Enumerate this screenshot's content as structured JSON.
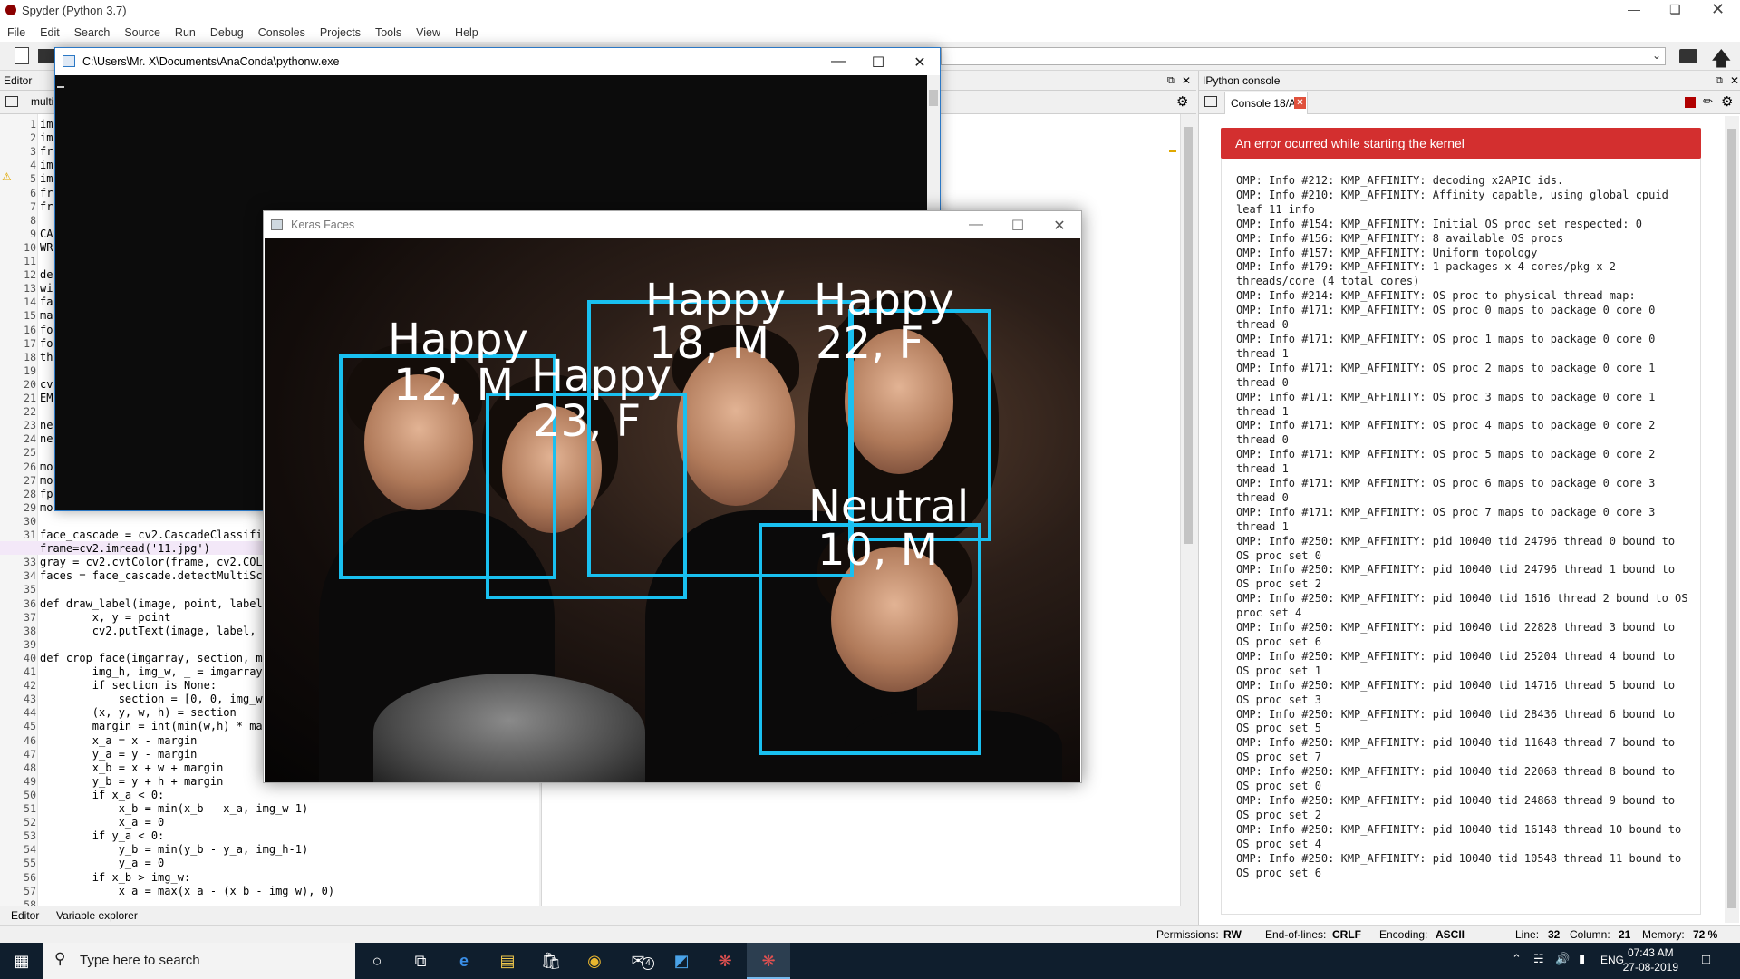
{
  "app": {
    "title": "Spyder (Python 3.7)"
  },
  "menu": [
    "File",
    "Edit",
    "Search",
    "Source",
    "Run",
    "Debug",
    "Consoles",
    "Projects",
    "Tools",
    "View",
    "Help"
  ],
  "editor": {
    "pane_title": "Editor",
    "tab": "multi",
    "line_numbers": [
      "1",
      "2",
      "3",
      "4",
      "5",
      "6",
      "7",
      "8",
      "9",
      "10",
      "11",
      "12",
      "13",
      "14",
      "15",
      "16",
      "17",
      "18",
      "19",
      "20",
      "21",
      "22",
      "23",
      "24",
      "25",
      "26",
      "27",
      "28",
      "29",
      "30",
      "31",
      "32",
      "33",
      "34",
      "35",
      "36",
      "37",
      "38",
      "39",
      "40",
      "41",
      "42",
      "43",
      "44",
      "45",
      "46",
      "47",
      "48",
      "49",
      "50",
      "51",
      "52",
      "53",
      "54",
      "55",
      "56",
      "57",
      "58"
    ],
    "code_lines": [
      "face_cascade = cv2.CascadeClassifie",
      "frame=cv2.imread('11.jpg')",
      "gray = cv2.cvtColor(frame, cv2.COLO",
      "faces = face_cascade.detectMultiSca",
      "",
      "def draw_label(image, point, label,",
      "        x, y = point",
      "        cv2.putText(image, label, p",
      "",
      "def crop_face(imgarray, section, ma",
      "        img_h, img_w, _ = imgarray.",
      "        if section is None:",
      "            section = [0, 0, img_w,",
      "        (x, y, w, h) = section",
      "        margin = int(min(w,h) * mar",
      "        x_a = x - margin",
      "        y_a = y - margin",
      "        x_b = x + w + margin",
      "        y_b = y + h + margin",
      "        if x_a < 0:",
      "            x_b = min(x_b - x_a, img_w-1)",
      "            x_a = 0",
      "        if y_a < 0:",
      "            y_b = min(y_b - y_a, img_h-1)",
      "            y_a = 0",
      "        if x_b > img_w:",
      "            x_a = max(x_a - (x_b - img_w), 0)"
    ],
    "left_fragments": [
      "im",
      "im",
      "fr",
      "im",
      "im",
      "fr",
      "fr",
      "",
      "CA",
      "WR",
      "",
      "de",
      "wi",
      "fa",
      "ma",
      "fo",
      "fo",
      "th",
      "",
      "cv",
      "EM",
      "",
      "ne",
      "ne",
      "",
      "mo",
      "mo",
      "fp",
      "mo"
    ]
  },
  "bottom_tabs": [
    "Editor",
    "Variable explorer"
  ],
  "console": {
    "pane_title": "IPython console",
    "tab": "Console 18/A",
    "error_banner": "An error ocurred while starting the kernel",
    "log": "OMP: Info #212: KMP_AFFINITY: decoding x2APIC ids.\nOMP: Info #210: KMP_AFFINITY: Affinity capable, using global cpuid leaf 11 info\nOMP: Info #154: KMP_AFFINITY: Initial OS proc set respected: 0\nOMP: Info #156: KMP_AFFINITY: 8 available OS procs\nOMP: Info #157: KMP_AFFINITY: Uniform topology\nOMP: Info #179: KMP_AFFINITY: 1 packages x 4 cores/pkg x 2 threads/core (4 total cores)\nOMP: Info #214: KMP_AFFINITY: OS proc to physical thread map:\nOMP: Info #171: KMP_AFFINITY: OS proc 0 maps to package 0 core 0 thread 0\nOMP: Info #171: KMP_AFFINITY: OS proc 1 maps to package 0 core 0 thread 1\nOMP: Info #171: KMP_AFFINITY: OS proc 2 maps to package 0 core 1 thread 0\nOMP: Info #171: KMP_AFFINITY: OS proc 3 maps to package 0 core 1 thread 1\nOMP: Info #171: KMP_AFFINITY: OS proc 4 maps to package 0 core 2 thread 0\nOMP: Info #171: KMP_AFFINITY: OS proc 5 maps to package 0 core 2 thread 1\nOMP: Info #171: KMP_AFFINITY: OS proc 6 maps to package 0 core 3 thread 0\nOMP: Info #171: KMP_AFFINITY: OS proc 7 maps to package 0 core 3 thread 1\nOMP: Info #250: KMP_AFFINITY: pid 10040 tid 24796 thread 0 bound to OS proc set 0\nOMP: Info #250: KMP_AFFINITY: pid 10040 tid 24796 thread 1 bound to OS proc set 2\nOMP: Info #250: KMP_AFFINITY: pid 10040 tid 1616 thread 2 bound to OS proc set 4\nOMP: Info #250: KMP_AFFINITY: pid 10040 tid 22828 thread 3 bound to OS proc set 6\nOMP: Info #250: KMP_AFFINITY: pid 10040 tid 25204 thread 4 bound to OS proc set 1\nOMP: Info #250: KMP_AFFINITY: pid 10040 tid 14716 thread 5 bound to OS proc set 3\nOMP: Info #250: KMP_AFFINITY: pid 10040 tid 28436 thread 6 bound to OS proc set 5\nOMP: Info #250: KMP_AFFINITY: pid 10040 tid 11648 thread 7 bound to OS proc set 7\nOMP: Info #250: KMP_AFFINITY: pid 10040 tid 22068 thread 8 bound to OS proc set 0\nOMP: Info #250: KMP_AFFINITY: pid 10040 tid 24868 thread 9 bound to OS proc set 2\nOMP: Info #250: KMP_AFFINITY: pid 10040 tid 16148 thread 10 bound to OS proc set 4\nOMP: Info #250: KMP_AFFINITY: pid 10040 tid 10548 thread 11 bound to OS proc set 6"
  },
  "status": {
    "permissions_label": "Permissions:",
    "permissions": "RW",
    "eol_label": "End-of-lines:",
    "eol": "CRLF",
    "encoding_label": "Encoding:",
    "encoding": "ASCII",
    "line_label": "Line:",
    "line": "32",
    "column_label": "Column:",
    "column": "21",
    "memory_label": "Memory:",
    "memory": "72 %"
  },
  "pythonw": {
    "title": "C:\\Users\\Mr. X\\Documents\\AnaConda\\pythonw.exe"
  },
  "keras": {
    "title": "Keras Faces",
    "faces": [
      {
        "emotion": "Happy",
        "age_gender": "12, M"
      },
      {
        "emotion": "Happy",
        "age_gender": "23, F"
      },
      {
        "emotion": "Happy",
        "age_gender": "18, M"
      },
      {
        "emotion": "Happy",
        "age_gender": "22, F"
      },
      {
        "emotion": "Neutral",
        "age_gender": "10, M"
      }
    ]
  },
  "taskbar": {
    "search_placeholder": "Type here to search",
    "time": "07:43 AM",
    "date": "27-08-2019",
    "language": "ENG",
    "mail_badge": "4"
  },
  "colors": {
    "box": "#19c0f0",
    "error": "#d32f2f",
    "taskbar": "#0f1e2d"
  }
}
